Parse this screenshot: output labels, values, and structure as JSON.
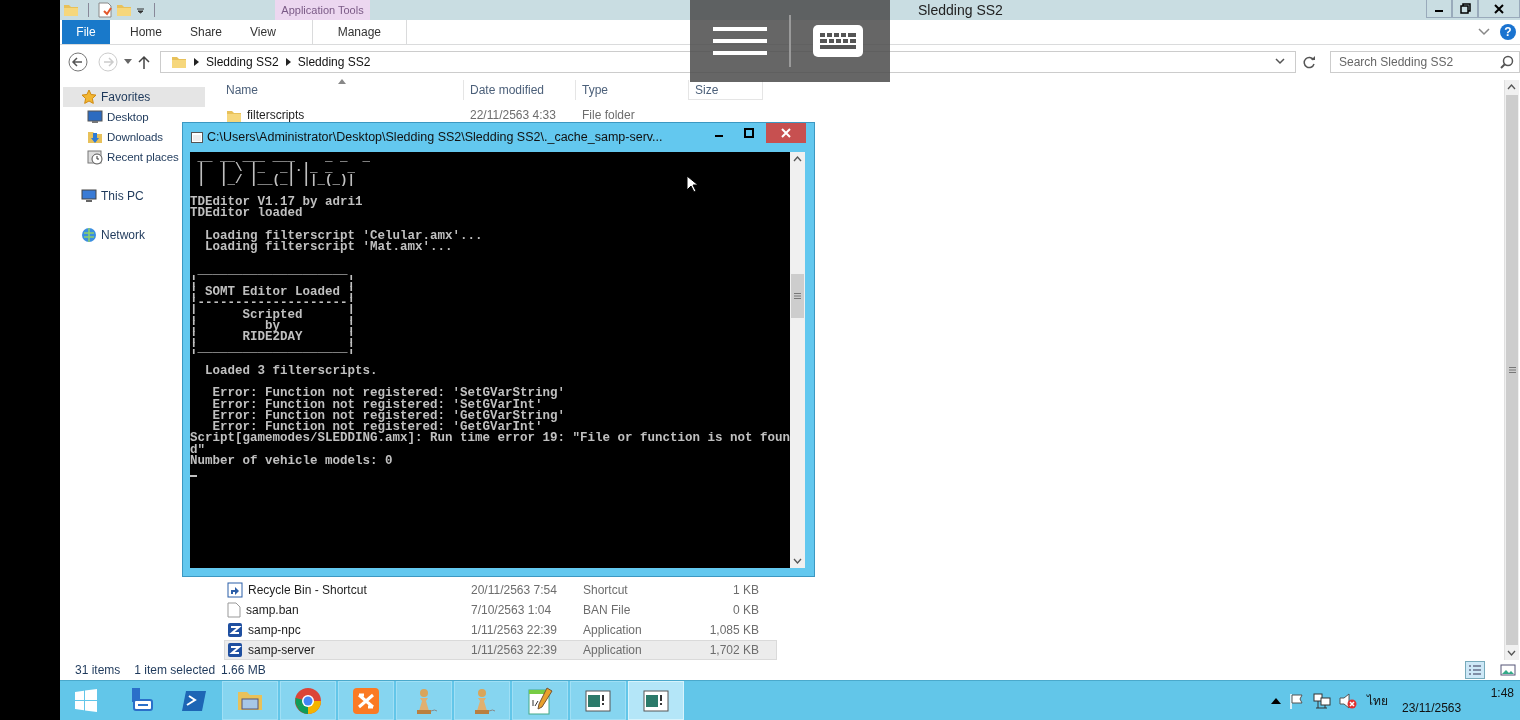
{
  "explorer": {
    "title": "Sledding SS2",
    "contextual_group": "Application Tools",
    "ribbon_tabs": [
      {
        "label": "File",
        "kind": "file",
        "selected": false
      },
      {
        "label": "Home",
        "kind": "plain",
        "selected": false
      },
      {
        "label": "Share",
        "kind": "plain",
        "selected": false
      },
      {
        "label": "View",
        "kind": "plain",
        "selected": false
      },
      {
        "label": "Manage",
        "kind": "contextual",
        "selected": false
      }
    ],
    "help": "?",
    "breadcrumbs": [
      "Sledding SS2",
      "Sledding SS2"
    ],
    "search": {
      "placeholder": "Search Sledding SS2"
    },
    "nav": [
      {
        "label": "Favorites",
        "kind": "star",
        "selected": true,
        "children": [
          {
            "label": "Desktop",
            "kind": "desktop",
            "selected": false
          },
          {
            "label": "Downloads",
            "kind": "downloads",
            "selected": false
          },
          {
            "label": "Recent places",
            "kind": "recent",
            "selected": false
          }
        ]
      },
      {
        "label": "This PC",
        "kind": "pc",
        "selected": false
      },
      {
        "label": "Network",
        "kind": "network",
        "selected": false
      }
    ],
    "columns": [
      "Name",
      "Date modified",
      "Type",
      "Size"
    ],
    "files": [
      {
        "name": "filterscripts",
        "date": "22/11/2563 4:33",
        "type": "File folder",
        "kind": "folder",
        "selected": false
      },
      {
        "name": "Recycle Bin - Shortcut",
        "date": "20/11/2563 7:54",
        "type": "Shortcut",
        "size": "1 KB",
        "kind": "shortcut",
        "selected": false
      },
      {
        "name": "samp.ban",
        "date": "7/10/2563 1:04",
        "type": "BAN File",
        "size": "0 KB",
        "kind": "file",
        "selected": false
      },
      {
        "name": "samp-npc",
        "date": "1/11/2563 22:39",
        "type": "Application",
        "size": "1,085 KB",
        "kind": "app",
        "selected": false
      },
      {
        "name": "samp-server",
        "date": "1/11/2563 22:39",
        "type": "Application",
        "size": "1,702 KB",
        "kind": "app",
        "selected": true
      }
    ],
    "status": {
      "count": "31 items",
      "selection": "1 item selected",
      "size": "1.66 MB"
    }
  },
  "console": {
    "title": "C:\\Users\\Administrator\\Desktop\\Sledding SS2\\Sledding SS2\\._cache_samp-serv...",
    "blocks": [
      [
        " __ __ ___ ___    _ _  _",
        " |  | \\ |_  _|.|_ _  _",
        " |  |_/ |__(_| ||_(_)|"
      ],
      [
        "TDEditor V1.17 by adri1",
        "TDEditor loaded"
      ],
      [
        "  Loading filterscript 'Celular.amx'...",
        "  Loading filterscript 'Mat.amx'..."
      ],
      [
        " ____________________",
        "¦                    ¦",
        "¦ SOMT Editor Loaded ¦",
        "¦--------------------¦",
        "¦      Scripted      ¦",
        "¦         by         ¦",
        "¦      RIDE2DAY      ¦",
        "¦____________________¦"
      ],
      [
        "  Loaded 3 filterscripts."
      ],
      [
        "   Error: Function not registered: 'SetGVarString'",
        "   Error: Function not registered: 'SetGVarInt'",
        "   Error: Function not registered: 'GetGVarString'",
        "   Error: Function not registered: 'GetGVarInt'",
        "Script[gamemodes/SLEDDING.amx]: Run time error 19: \"File or function is not foun",
        "d\"",
        "Number of vehicle models: 0"
      ]
    ]
  },
  "taskbar": {
    "buttons": [
      {
        "kind": "start",
        "running": false,
        "selected": false
      },
      {
        "kind": "server",
        "running": false,
        "selected": false
      },
      {
        "kind": "shell",
        "running": false,
        "selected": false
      },
      {
        "kind": "explorer",
        "running": true,
        "selected": false
      },
      {
        "kind": "chrome",
        "running": true,
        "selected": false
      },
      {
        "kind": "xampp",
        "running": true,
        "selected": false
      },
      {
        "kind": "pawn",
        "running": true,
        "selected": false
      },
      {
        "kind": "pawn",
        "running": true,
        "selected": false
      },
      {
        "kind": "notepad",
        "running": true,
        "selected": false
      },
      {
        "kind": "window",
        "running": true,
        "selected": false
      },
      {
        "kind": "window",
        "running": true,
        "selected": true
      }
    ],
    "tray": {
      "language": "ไทย",
      "time": "1:48",
      "date": "23/11/2563"
    }
  }
}
